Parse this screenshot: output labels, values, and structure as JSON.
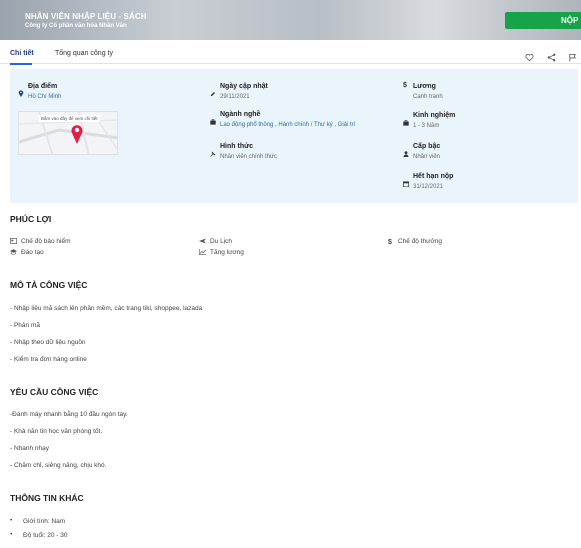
{
  "header": {
    "job_title": "NHÂN VIÊN NHẬP LIỆU - SÁCH",
    "company": "Công ty Cổ phần văn hóa Nhân Văn",
    "apply_label": "NỘP"
  },
  "tabs": [
    {
      "label": "Chi tiết",
      "active": true
    },
    {
      "label": "Tổng quan công ty",
      "active": false
    }
  ],
  "actions": {
    "icons": [
      "heart-icon",
      "share-icon",
      "flag-icon"
    ]
  },
  "info": {
    "location": {
      "label": "Địa điểm",
      "value": "Hồ Chí Minh",
      "icon": "pin-icon"
    },
    "map_hint": "Bấm vào đây để xem chi tiết",
    "updated": {
      "label": "Ngày cập nhật",
      "value": "29/11/2021",
      "icon": "edit-icon"
    },
    "industry": {
      "label": "Ngành nghề",
      "value": "Lao động phổ thông , Hành chính / Thư ký , Giải trí",
      "icon": "briefcase-icon"
    },
    "form": {
      "label": "Hình thức",
      "value": "Nhân viên chính thức",
      "icon": "pushpin-icon"
    },
    "salary": {
      "label": "Lương",
      "value": "Cạnh tranh",
      "icon": "dollar-icon"
    },
    "experience": {
      "label": "Kinh nghiệm",
      "value": "1 - 3 Năm",
      "icon": "briefcase-icon"
    },
    "level": {
      "label": "Cấp bậc",
      "value": "Nhân viên",
      "icon": "user-icon"
    },
    "deadline": {
      "label": "Hết hạn nộp",
      "value": "31/12/2021",
      "icon": "calendar-icon"
    }
  },
  "benefits": {
    "title": "PHÚC LỢI",
    "items": [
      {
        "label": "Chế độ bảo hiểm",
        "icon": "insurance-icon"
      },
      {
        "label": "Du Lịch",
        "icon": "plane-icon"
      },
      {
        "label": "Chế độ thưởng",
        "icon": "dollar-icon"
      },
      {
        "label": "Đào tạo",
        "icon": "graduation-icon"
      },
      {
        "label": "Tăng lương",
        "icon": "chart-icon"
      }
    ]
  },
  "description": {
    "title": "MÔ TẢ CÔNG VIỆC",
    "lines": [
      "- Nhập liệu mã sách lên phần mềm, các trang tiki, shoppee, lazada",
      "- Phân mã",
      "- Nhập theo dữ liệu nguồn",
      "- Kiểm tra đơn hàng online"
    ]
  },
  "requirements": {
    "title": "YÊU CẦU CÔNG VIỆC",
    "lines": [
      "-Đánh máy nhanh bằng 10 đầu ngón tay.",
      "- Khả năn tin học văn phòng tốt.",
      "- Nhanh nhạy",
      "- Chăm chỉ, siêng năng, chịu khó."
    ]
  },
  "other": {
    "title": "THÔNG TIN KHÁC",
    "items": [
      "Giới tính: Nam",
      "Độ tuổi: 20 - 30"
    ]
  },
  "colors": {
    "accent": "#2563eb",
    "apply": "#16a34a",
    "panel": "#eaf5fb",
    "pin": "#e11d48"
  }
}
